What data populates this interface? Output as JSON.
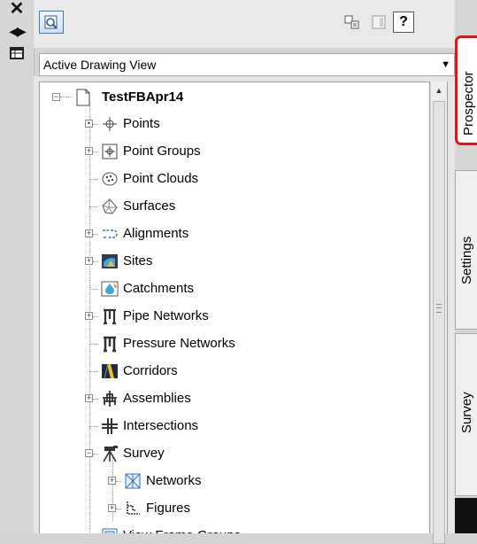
{
  "palette": {
    "highlight": "#e2151d",
    "tool_button_border": "#3b77c8",
    "tree_background": "#ffffff",
    "panel_background": "#d6d6d6"
  },
  "left_strip": {
    "icons": [
      "close-icon",
      "auto-hide-icon",
      "properties-icon"
    ]
  },
  "toolbar": {
    "buttons": [
      "item-view-icon",
      "toggle-item-view-icon",
      "panel-options-icon",
      "help-button"
    ],
    "help_label": "?"
  },
  "view_select": {
    "selected": "Active Drawing View"
  },
  "tree": {
    "root": "TestFBApr14",
    "items": [
      {
        "label": "Points",
        "icon": "points-icon",
        "expander": "dot"
      },
      {
        "label": "Point Groups",
        "icon": "point-groups-icon",
        "expander": "plus"
      },
      {
        "label": "Point Clouds",
        "icon": "point-clouds-icon",
        "expander": "none"
      },
      {
        "label": "Surfaces",
        "icon": "surfaces-icon",
        "expander": "none"
      },
      {
        "label": "Alignments",
        "icon": "alignments-icon",
        "expander": "plus"
      },
      {
        "label": "Sites",
        "icon": "sites-icon",
        "expander": "plus"
      },
      {
        "label": "Catchments",
        "icon": "catchments-icon",
        "expander": "none"
      },
      {
        "label": "Pipe Networks",
        "icon": "pipe-networks-icon",
        "expander": "plus"
      },
      {
        "label": "Pressure Networks",
        "icon": "pressure-networks-icon",
        "expander": "none"
      },
      {
        "label": "Corridors",
        "icon": "corridors-icon",
        "expander": "none"
      },
      {
        "label": "Assemblies",
        "icon": "assemblies-icon",
        "expander": "plus"
      },
      {
        "label": "Intersections",
        "icon": "intersections-icon",
        "expander": "none"
      },
      {
        "label": "Survey",
        "icon": "survey-icon",
        "expander": "minus"
      },
      {
        "label": "Networks",
        "icon": "networks-icon",
        "expander": "plus"
      },
      {
        "label": "Figures",
        "icon": "figures-icon",
        "expander": "plus"
      },
      {
        "label": "View Frame Groups",
        "icon": "view-frame-groups-icon",
        "expander": "none"
      }
    ]
  },
  "tabs": [
    {
      "label": "Prospector",
      "active": true
    },
    {
      "label": "Settings",
      "active": false
    },
    {
      "label": "Survey",
      "active": false
    }
  ]
}
